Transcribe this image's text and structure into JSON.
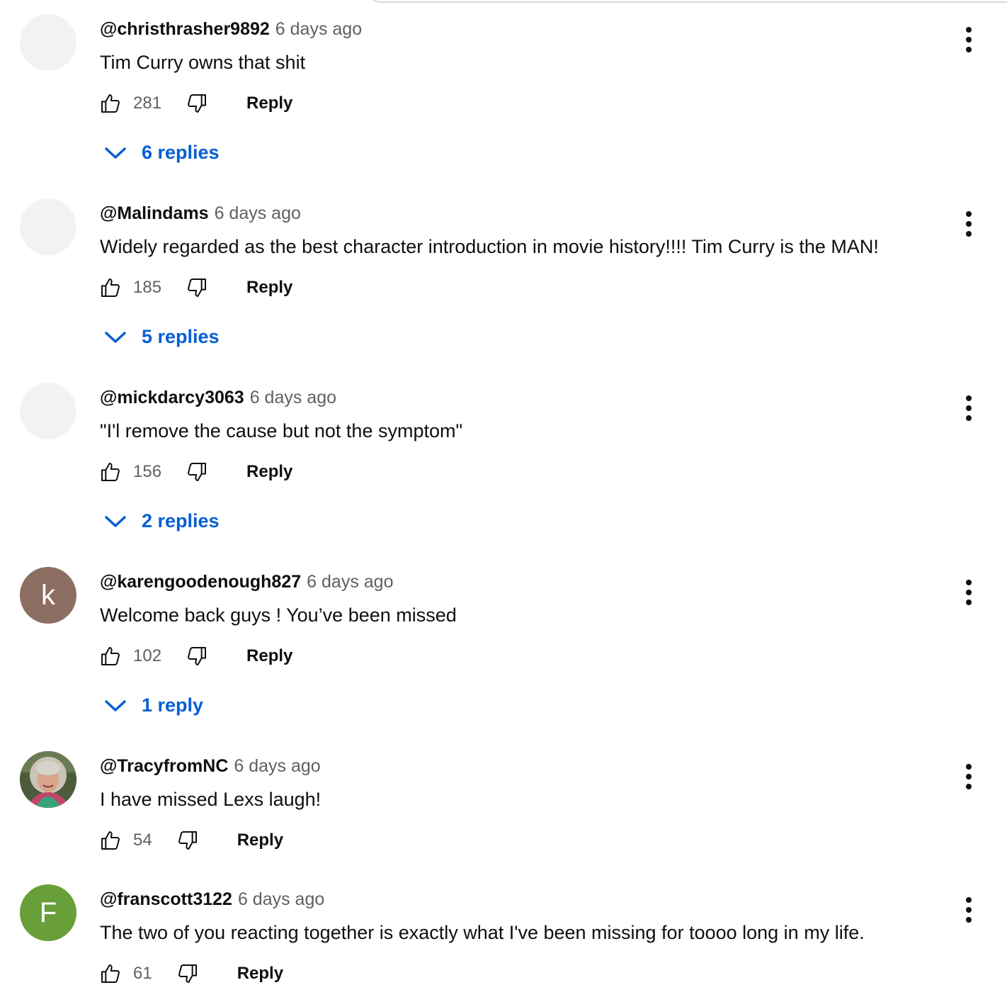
{
  "comments": [
    {
      "author": "@christhrasher9892",
      "time": "6 days ago",
      "text": "Tim Curry owns that shit",
      "likes": "281",
      "reply_label": "Reply",
      "replies_label": "6 replies",
      "avatar": {
        "letter": "",
        "color": "#f2f2f2"
      }
    },
    {
      "author": "@Malindams",
      "time": "6 days ago",
      "text": "Widely regarded as the best character introduction in movie history!!!!  Tim Curry is the MAN!",
      "likes": "185",
      "reply_label": "Reply",
      "replies_label": "5 replies",
      "avatar": {
        "letter": "",
        "color": "#f2f2f2"
      }
    },
    {
      "author": "@mickdarcy3063",
      "time": "6 days ago",
      "text": "\"I'l remove the cause but not the symptom\"",
      "likes": "156",
      "reply_label": "Reply",
      "replies_label": "2 replies",
      "avatar": {
        "letter": "",
        "color": "#f2f2f2"
      }
    },
    {
      "author": "@karengoodenough827",
      "time": "6 days ago",
      "text": "Welcome back guys ! You’ve been missed",
      "likes": "102",
      "reply_label": "Reply",
      "replies_label": "1 reply",
      "avatar": {
        "letter": "k",
        "color": "#8d6e63"
      }
    },
    {
      "author": "@TracyfromNC",
      "time": "6 days ago",
      "text": "I have missed Lexs laugh!",
      "likes": "54",
      "reply_label": "Reply",
      "replies_label": "",
      "avatar": {
        "letter": "",
        "color": "#4a5a3a"
      }
    },
    {
      "author": "@franscott3122",
      "time": "6 days ago",
      "text": "The two of you reacting together is exactly what I've been missing for toooo long in my life.",
      "likes": "61",
      "reply_label": "Reply",
      "replies_label": "",
      "avatar": {
        "letter": "F",
        "color": "#689f38"
      }
    }
  ],
  "colors": {
    "link": "#065fd4",
    "meta": "#606060",
    "text": "#0f0f0f"
  },
  "icons": {
    "like": "thumbs-up-icon",
    "dislike": "thumbs-down-icon",
    "more": "more-vert-icon",
    "expand": "chevron-down-icon"
  }
}
